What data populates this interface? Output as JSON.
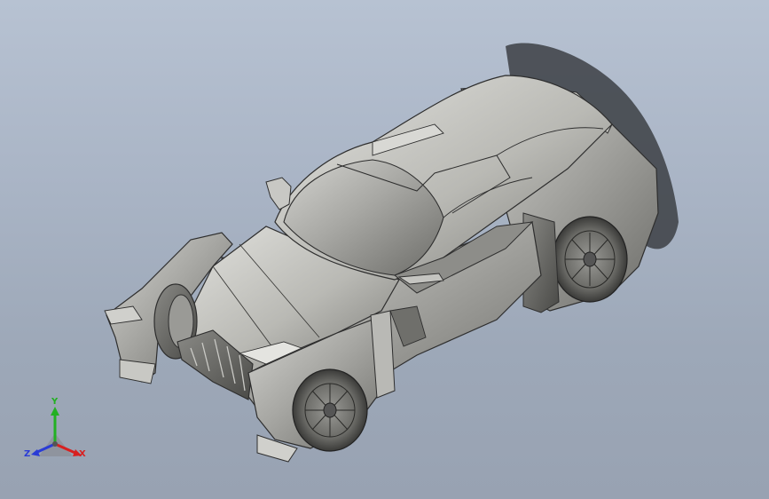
{
  "viewport": {
    "background_top": "#b7c2d2",
    "background_bottom": "#98a2b2",
    "model_color": "#b4b4b0",
    "edge_color": "#2e2e2e"
  },
  "triad": {
    "x_label": "X",
    "y_label": "Y",
    "z_label": "Z",
    "x_color": "#d82020",
    "y_color": "#22b022",
    "z_color": "#2a3cd6"
  }
}
